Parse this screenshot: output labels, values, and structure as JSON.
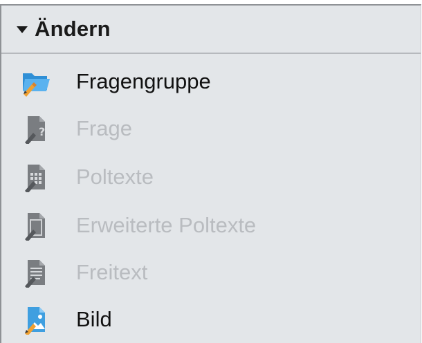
{
  "section": {
    "title": "Ändern",
    "collapse_icon": "caret-down-icon"
  },
  "items": [
    {
      "label": "Fragengruppe",
      "icon": "folder-edit-icon",
      "enabled": true
    },
    {
      "label": "Frage",
      "icon": "question-document-edit-icon",
      "enabled": false
    },
    {
      "label": "Poltexte",
      "icon": "grid-document-edit-icon",
      "enabled": false
    },
    {
      "label": "Erweiterte Poltexte",
      "icon": "extended-document-edit-icon",
      "enabled": false
    },
    {
      "label": "Freitext",
      "icon": "text-document-edit-icon",
      "enabled": false
    },
    {
      "label": "Bild",
      "icon": "image-edit-icon",
      "enabled": true
    }
  ],
  "colors": {
    "panel_bg": "#e3e6e9",
    "enabled_text": "#111111",
    "disabled_text": "#b9bcc0",
    "folder_blue": "#3f9fe0",
    "pencil_orange": "#f0a030",
    "disabled_icon": "#6e7074"
  }
}
